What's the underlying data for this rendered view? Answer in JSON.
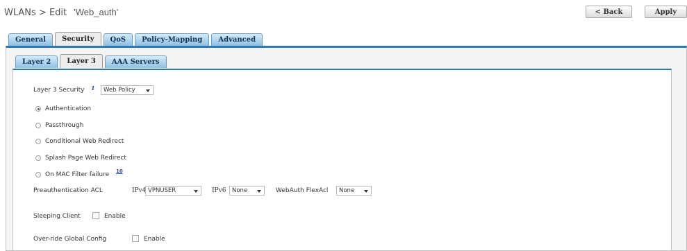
{
  "header": {
    "breadcrumb_prefix": "WLANs > Edit",
    "wlan_name": "'Web_auth'",
    "back_label": "< Back",
    "apply_label": "Apply"
  },
  "tabs": [
    "General",
    "Security",
    "QoS",
    "Policy-Mapping",
    "Advanced"
  ],
  "active_tab": "Security",
  "subtabs": [
    "Layer 2",
    "Layer 3",
    "AAA Servers"
  ],
  "active_subtab": "Layer 3",
  "layer3": {
    "security_label": "Layer 3 Security",
    "security_value": "Web Policy",
    "info_marker": "1",
    "options": [
      {
        "label": "Authentication",
        "checked": true
      },
      {
        "label": "Passthrough",
        "checked": false
      },
      {
        "label": "Conditional Web Redirect",
        "checked": false
      },
      {
        "label": "Splash Page Web Redirect",
        "checked": false
      },
      {
        "label": "On MAC Filter failure",
        "checked": false
      }
    ],
    "mac_filter_note": "10",
    "preauth_label": "Preauthentication ACL",
    "ipv4_label": "IPv4",
    "ipv4_value": "VPNUSER",
    "ipv6_label": "IPv6",
    "ipv6_value": "None",
    "flexacl_label": "WebAuth FlexAcl",
    "flexacl_value": "None",
    "sleeping_label": "Sleeping Client",
    "sleeping_enable": "Enable",
    "sleeping_checked": false,
    "override_label": "Over-ride Global Config",
    "override_enable": "Enable",
    "override_checked": false
  }
}
